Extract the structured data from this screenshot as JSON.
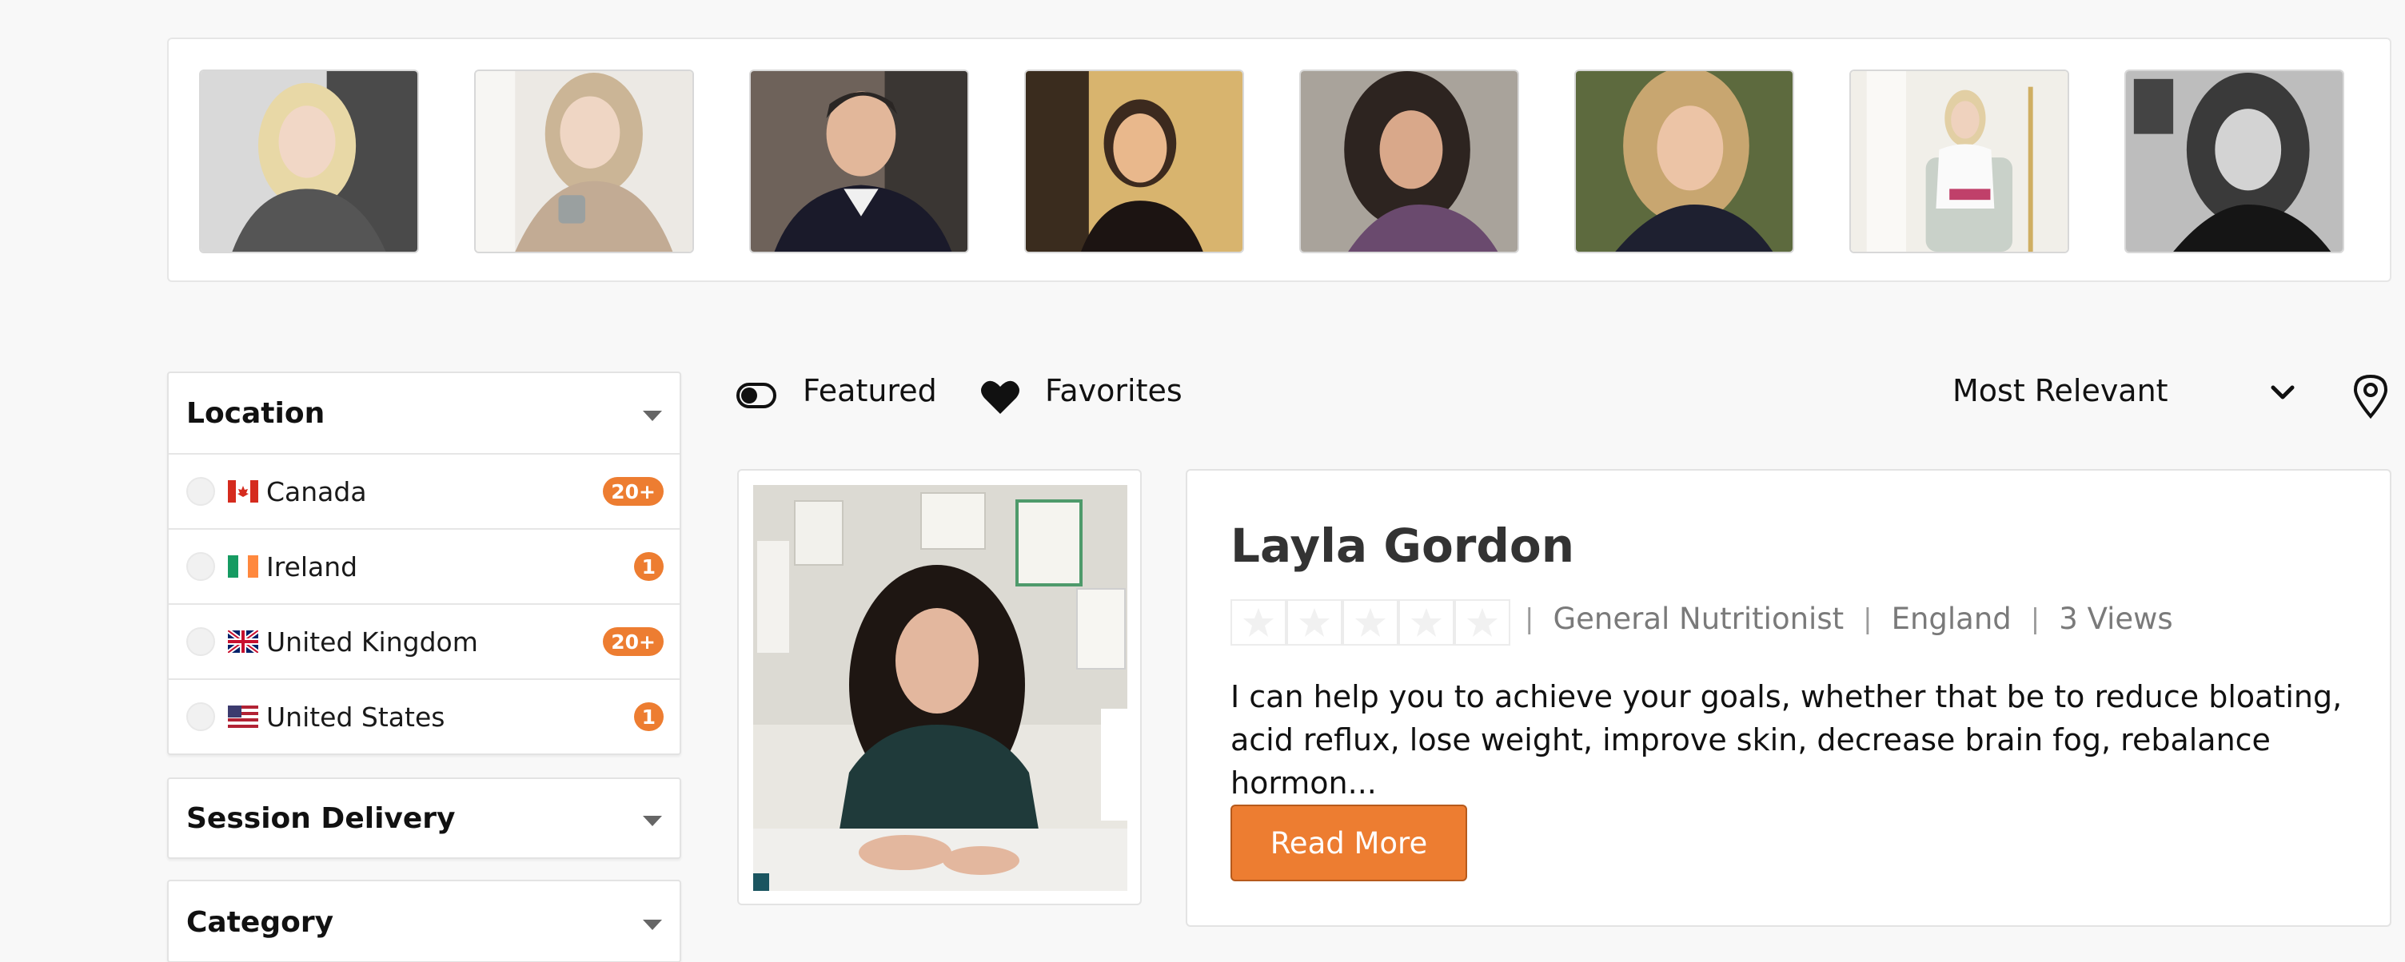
{
  "carousel": {
    "profiles": [
      {
        "alt": "profile-photo-1"
      },
      {
        "alt": "profile-photo-2"
      },
      {
        "alt": "profile-photo-3"
      },
      {
        "alt": "profile-photo-4"
      },
      {
        "alt": "profile-photo-5"
      },
      {
        "alt": "profile-photo-6"
      },
      {
        "alt": "profile-photo-7"
      },
      {
        "alt": "profile-photo-8"
      }
    ]
  },
  "sidebar": {
    "location": {
      "title": "Location",
      "items": [
        {
          "name": "Canada",
          "count": "20+",
          "flag": "ca"
        },
        {
          "name": "Ireland",
          "count": "1",
          "flag": "ie"
        },
        {
          "name": "United Kingdom",
          "count": "20+",
          "flag": "uk"
        },
        {
          "name": "United States",
          "count": "1",
          "flag": "us"
        }
      ]
    },
    "session_delivery": {
      "title": "Session Delivery"
    },
    "category": {
      "title": "Category"
    }
  },
  "filters": {
    "featured_label": "Featured",
    "favorites_label": "Favorites",
    "sort_label": "Most Relevant"
  },
  "listing": {
    "name": "Layla Gordon",
    "rating_stars": 0,
    "rating_max": 5,
    "specialty": "General Nutritionist",
    "region": "England",
    "views": "3 Views",
    "description": "I can help you to achieve your goals, whether that be to reduce bloating, acid reflux, lose weight, improve skin, decrease brain fog, rebalance hormon...",
    "read_more_label": "Read More"
  },
  "colors": {
    "accent": "#ed7d31",
    "page_bg": "#f8f8f8",
    "card_bg": "#ffffff"
  }
}
